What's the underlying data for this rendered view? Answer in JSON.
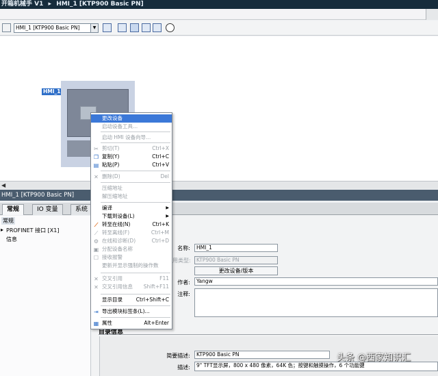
{
  "titlebar": {
    "part1": "开箱机械手 V1",
    "sep": "▸",
    "part2": "HMI_1 [KTP900 Basic PN]"
  },
  "toolbar": {
    "device_select": "HMI_1 [KTP900 Basic PN]",
    "select_arrow": "▼",
    "icons": [
      "network-icon",
      "props-icon",
      "table-icon",
      "grid-icon",
      "panel-icon",
      "zoom-icon"
    ]
  },
  "canvas": {
    "device_label": "HMI_1"
  },
  "hscroll": {
    "left_arrow": "◀"
  },
  "properties": {
    "header": "HMI_1 [KTP900 Basic PN]",
    "tabs": [
      "常规",
      "IO 变量",
      "系统"
    ],
    "nav": [
      "常规",
      "PROFINET 接口 [X1]",
      "信息"
    ],
    "nav_arrow": "▸",
    "fields": {
      "name_label": "名称:",
      "name_value": "HMI_1",
      "type_label": "用类型:",
      "type_value": "KTP900 Basic PN",
      "change_button": "更改设备/版本",
      "author_label": "作者:",
      "author_value": "Yangw",
      "comment_label": "注释:"
    },
    "catalog": {
      "title": "目录信息",
      "short_desc_label": "简要描述:",
      "short_desc_value": "KTP900 Basic PN",
      "desc_label": "描述:",
      "desc_value": "9\" TFT显示屏，800 x 480 像素，64K 色；按键和触摸操作，6 个功能键"
    }
  },
  "context_menu": {
    "items": [
      {
        "label": "更改设备",
        "shortcut": "",
        "state": "highlight",
        "icon": ""
      },
      {
        "label": "启动设备工具...",
        "shortcut": "",
        "state": "disabled",
        "icon": ""
      },
      {
        "label": "启动 HMI 设备向导...",
        "shortcut": "",
        "state": "disabled",
        "icon": ""
      },
      {
        "label": "剪切(T)",
        "shortcut": "Ctrl+X",
        "state": "disabled",
        "icon": "✂"
      },
      {
        "label": "复制(Y)",
        "shortcut": "Ctrl+C",
        "state": "enabled",
        "icon": "❐"
      },
      {
        "label": "粘贴(P)",
        "shortcut": "Ctrl+V",
        "state": "enabled",
        "icon": "▤"
      },
      {
        "label": "删除(D)",
        "shortcut": "Del",
        "state": "disabled",
        "icon": "✕"
      },
      {
        "label": "压缩地址",
        "shortcut": "",
        "state": "disabled",
        "icon": ""
      },
      {
        "label": "解压缩地址",
        "shortcut": "",
        "state": "disabled",
        "icon": ""
      },
      {
        "label": "编译",
        "shortcut": "",
        "state": "enabled",
        "icon": "",
        "submenu": true
      },
      {
        "label": "下载到设备(L)",
        "shortcut": "",
        "state": "enabled",
        "icon": "",
        "submenu": true
      },
      {
        "label": "转至在线(N)",
        "shortcut": "Ctrl+K",
        "state": "enabled",
        "icon": "⟋"
      },
      {
        "label": "转至离线(F)",
        "shortcut": "Ctrl+M",
        "state": "disabled",
        "icon": "⟋"
      },
      {
        "label": "在线和诊断(D)",
        "shortcut": "Ctrl+D",
        "state": "disabled",
        "icon": "⚙"
      },
      {
        "label": "分配设备名称",
        "shortcut": "",
        "state": "disabled",
        "icon": "▣"
      },
      {
        "label": "接收报警",
        "shortcut": "",
        "state": "disabled",
        "icon": "☐"
      },
      {
        "label": "更新并显示强制的操作数",
        "shortcut": "",
        "state": "disabled",
        "icon": ""
      },
      {
        "label": "交叉引用",
        "shortcut": "F11",
        "state": "disabled",
        "icon": "✕"
      },
      {
        "label": "交叉引用信息",
        "shortcut": "Shift+F11",
        "state": "disabled",
        "icon": "✕"
      },
      {
        "label": "显示目录",
        "shortcut": "Ctrl+Shift+C",
        "state": "enabled",
        "icon": ""
      },
      {
        "label": "导出模块标签条(L)...",
        "shortcut": "",
        "state": "enabled",
        "icon": "⇥"
      },
      {
        "label": "属性",
        "shortcut": "Alt+Enter",
        "state": "enabled",
        "icon": "▦"
      }
    ],
    "submenu_arrow": "▶"
  },
  "watermark": "头条 @西家知识汇",
  "colors": {
    "titlebar": "#162c3c",
    "highlight": "#3b78d8",
    "device_label": "#2f6fc8",
    "props_header": "#4a5c6e"
  }
}
